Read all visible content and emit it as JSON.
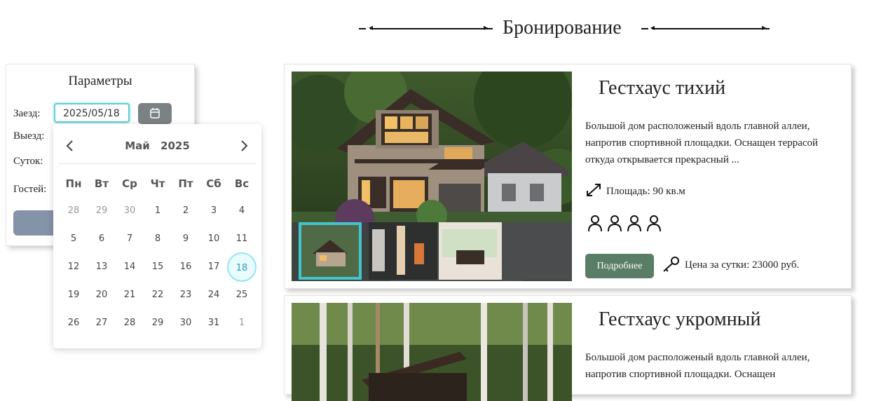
{
  "header": {
    "title": "Бронирование"
  },
  "params": {
    "title": "Параметры",
    "checkin_label": "Заезд:",
    "checkin_value": "2025/05/18",
    "checkout_label": "Выезд:",
    "nights_label": "Суток:",
    "guests_label": "Гостей:",
    "calendar_icon": "calendar-icon"
  },
  "calendar": {
    "month": "Май",
    "year": "2025",
    "weekdays": [
      "Пн",
      "Вт",
      "Ср",
      "Чт",
      "Пт",
      "Сб",
      "Вс"
    ],
    "weeks": [
      [
        "28",
        "29",
        "30",
        "1",
        "2",
        "3",
        "4"
      ],
      [
        "5",
        "6",
        "7",
        "8",
        "9",
        "10",
        "11"
      ],
      [
        "12",
        "13",
        "14",
        "15",
        "16",
        "17",
        "18"
      ],
      [
        "19",
        "20",
        "21",
        "22",
        "23",
        "24",
        "25"
      ],
      [
        "26",
        "27",
        "28",
        "29",
        "30",
        "31",
        "1"
      ]
    ],
    "selected": "18"
  },
  "cards": [
    {
      "title": "Гестхаус тихий",
      "description": "Большой дом расположеный вдоль главной аллеи, напротив спортивной площадки. Оснащен террасой откуда открывается прекрасный ...",
      "area": "Площадь: 90 кв.м",
      "guests": 4,
      "more_label": "Подробнее",
      "price": "Цена за сутки: 23000 руб."
    },
    {
      "title": "Гестхаус укромный",
      "description": "Большой дом расположеный вдоль главной аллеи, напротив спортивной площадки. Оснащен"
    }
  ],
  "colors": {
    "accent": "#5ccfd6",
    "primary_button": "#5a7d66",
    "calendar_button": "#7c8283"
  }
}
